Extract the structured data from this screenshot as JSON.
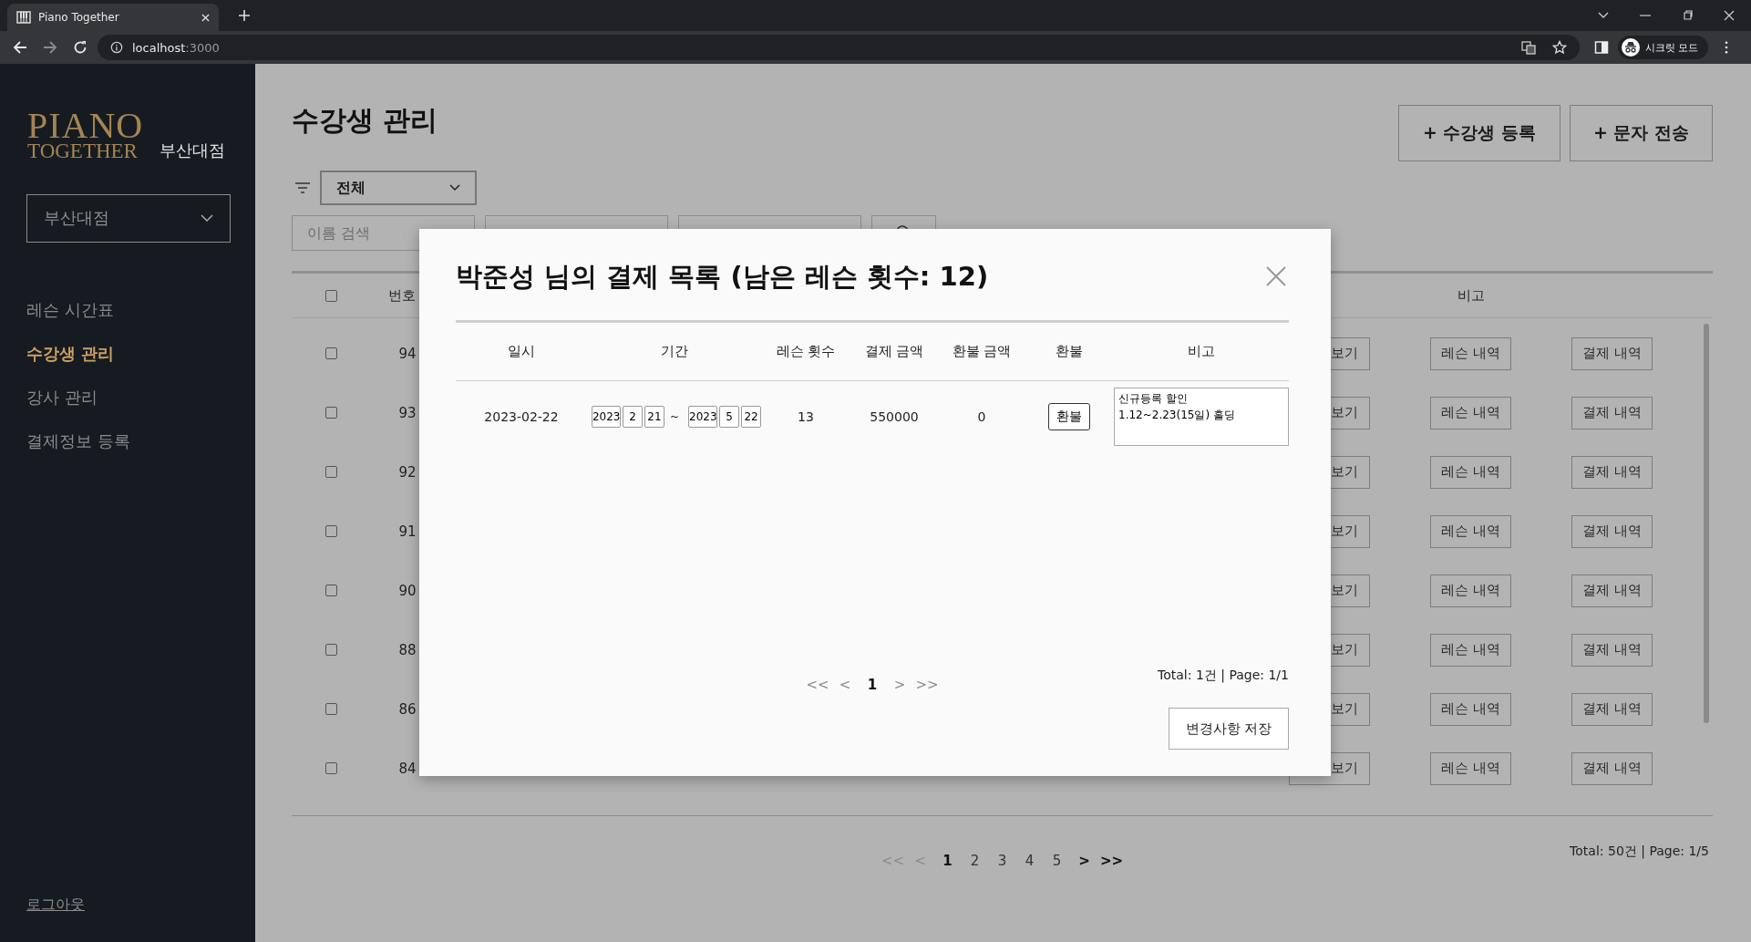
{
  "browser": {
    "tab_title": "Piano Together",
    "url_host": "localhost",
    "url_port": ":3000",
    "profile_label": "시크릿 모드"
  },
  "sidebar": {
    "logo_top": "PIANO",
    "logo_bottom": "TOGETHER",
    "branch_name": "부산대점",
    "branch_select": "부산대점",
    "nav": [
      {
        "label": "레슨 시간표",
        "selected": false
      },
      {
        "label": "수강생 관리",
        "selected": true
      },
      {
        "label": "강사 관리",
        "selected": false
      },
      {
        "label": "결제정보 등록",
        "selected": false
      }
    ],
    "logout": "로그아웃"
  },
  "page": {
    "title": "수강생 관리",
    "actions": [
      "+ 수강생 등록",
      "+ 문자 전송"
    ],
    "filter": "전체",
    "search_placeholder": "이름 검색",
    "table": {
      "header_checked": false,
      "number_header": "번호",
      "note_header": "비고",
      "rows": [
        {
          "checked": false,
          "number": "94",
          "buttons": [
            "보기",
            "레슨 내역",
            "결제 내역"
          ]
        },
        {
          "checked": false,
          "number": "93",
          "buttons": [
            "보기",
            "레슨 내역",
            "결제 내역"
          ]
        },
        {
          "checked": false,
          "number": "92",
          "buttons": [
            "보기",
            "레슨 내역",
            "결제 내역"
          ]
        },
        {
          "checked": false,
          "number": "91",
          "buttons": [
            "보기",
            "레슨 내역",
            "결제 내역"
          ]
        },
        {
          "checked": false,
          "number": "90",
          "buttons": [
            "보기",
            "레슨 내역",
            "결제 내역"
          ]
        },
        {
          "checked": false,
          "number": "88",
          "buttons": [
            "보기",
            "레슨 내역",
            "결제 내역"
          ]
        },
        {
          "checked": false,
          "number": "86",
          "buttons": [
            "보기",
            "레슨 내역",
            "결제 내역"
          ]
        },
        {
          "checked": false,
          "number": "84",
          "buttons": [
            "보기",
            "레슨 내역",
            "결제 내역"
          ]
        }
      ]
    },
    "pagination": [
      {
        "kind": "arrow",
        "label": "<<",
        "disabled": true
      },
      {
        "kind": "arrow",
        "label": "<",
        "disabled": true
      },
      {
        "kind": "page",
        "label": "1",
        "selected": true
      },
      {
        "kind": "page",
        "label": "2",
        "selected": false
      },
      {
        "kind": "page",
        "label": "3",
        "selected": false
      },
      {
        "kind": "page",
        "label": "4",
        "selected": false
      },
      {
        "kind": "page",
        "label": "5",
        "selected": false
      },
      {
        "kind": "arrow",
        "label": ">",
        "disabled": false
      },
      {
        "kind": "arrow",
        "label": ">>",
        "disabled": false
      }
    ],
    "total": "Total: 50건 | Page: 1/5"
  },
  "modal": {
    "title": "박준성 님의 결제 목록 (남은 레슨 횟수: 12)",
    "columns": [
      "일시",
      "기간",
      "레슨 횟수",
      "결제 금액",
      "환불 금액",
      "환불",
      "비고"
    ],
    "rows": [
      {
        "date": "2023-02-22",
        "start": [
          "2023",
          "2",
          "21"
        ],
        "separator": "~",
        "end": [
          "2023",
          "5",
          "22"
        ],
        "lessons": "13",
        "paid": "550000",
        "refunded": "0",
        "refund_button": "환불",
        "note": "신규등록 할인\n1.12~2.23(15일) 홀딩"
      }
    ],
    "pagination": [
      {
        "kind": "arrow",
        "label": "<<",
        "disabled": true
      },
      {
        "kind": "arrow",
        "label": "<",
        "disabled": true
      },
      {
        "kind": "page",
        "label": "1",
        "selected": true
      },
      {
        "kind": "arrow",
        "label": ">",
        "disabled": true
      },
      {
        "kind": "arrow",
        "label": ">>",
        "disabled": true
      }
    ],
    "total": "Total: 1건 | Page: 1/1",
    "save_button": "변경사항 저장"
  }
}
